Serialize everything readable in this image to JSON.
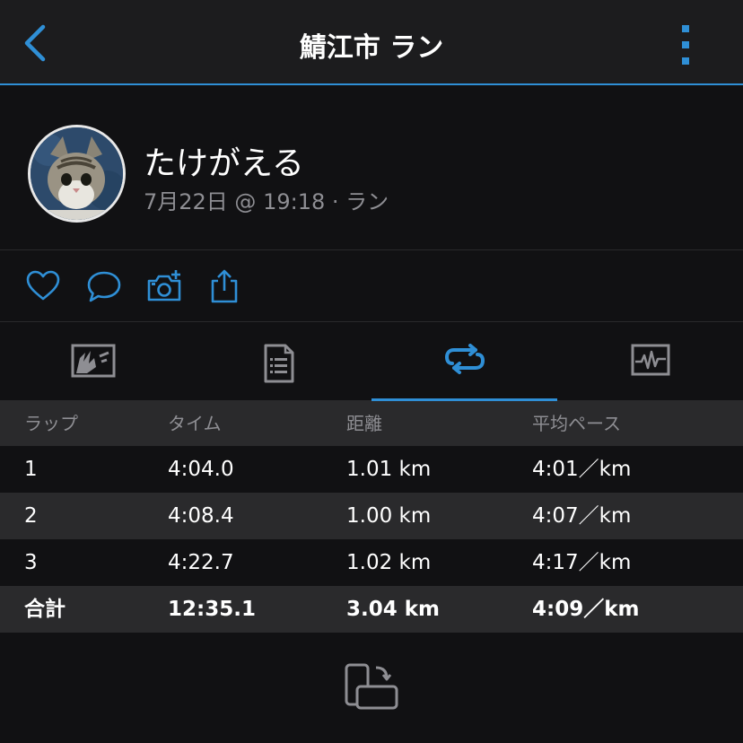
{
  "header": {
    "title": "鯖江市 ラン",
    "accent_color": "#2f8fd6",
    "back_icon": "chevron-left-icon",
    "menu_icon": "more-vertical-icon"
  },
  "profile": {
    "name": "たけがえる",
    "meta": "7月22日 @ 19:18 · ラン",
    "avatar": "cat-photo-avatar"
  },
  "actions": [
    "heart-icon",
    "comment-icon",
    "add-photo-icon",
    "share-icon"
  ],
  "tabs": {
    "items": [
      "map-icon",
      "document-icon",
      "laps-icon",
      "chart-icon"
    ],
    "active_index": 2
  },
  "laps": {
    "headers": [
      "ラップ",
      "タイム",
      "距離",
      "平均ペース"
    ],
    "rows": [
      [
        "1",
        "4:04.0",
        "1.01 km",
        "4:01／km"
      ],
      [
        "2",
        "4:08.4",
        "1.00 km",
        "4:07／km"
      ],
      [
        "3",
        "4:22.7",
        "1.02 km",
        "4:17／km"
      ]
    ],
    "total": [
      "合計",
      "12:35.1",
      "3.04 km",
      "4:09／km"
    ]
  },
  "footer": {
    "rotate_icon": "rotate-device-icon"
  }
}
